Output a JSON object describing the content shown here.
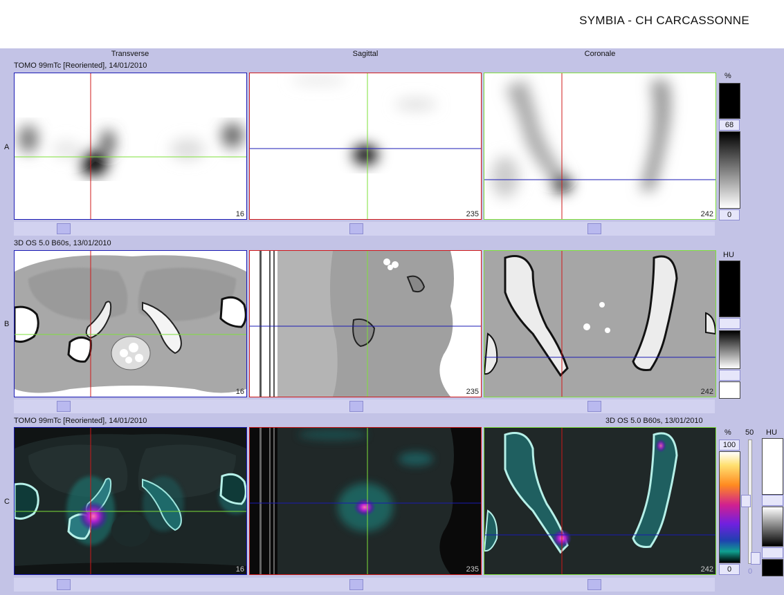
{
  "header": {
    "site_title": "SYMBIA - CH CARCASSONNE"
  },
  "columns": {
    "transverse": "Transverse",
    "sagittal": "Sagittal",
    "coronal": "Coronale"
  },
  "rows": {
    "a": {
      "letter": "A",
      "series": "TOMO 99mTc [Reoriented], 14/01/2010",
      "scale_unit": "%",
      "scale_top": "68",
      "scale_bottom": "0"
    },
    "b": {
      "letter": "B",
      "series": "3D  OS  5.0  B60s, 13/01/2010",
      "scale_unit": "HU"
    },
    "c": {
      "letter": "C",
      "series_left": "TOMO 99mTc [Reoriented], 14/01/2010",
      "series_right": "3D  OS  5.0  B60s, 13/01/2010",
      "scale_unit_pct": "%",
      "scale_unit_hu": "HU",
      "pct_top": "100",
      "pct_bottom": "0",
      "blend_top": "50",
      "blend_bottom": "0"
    }
  },
  "slices": {
    "transverse": "16",
    "sagittal": "235",
    "coronal": "242"
  },
  "colors": {
    "red_crosshair": "#d01818",
    "green_crosshair": "#7ee03a",
    "blue_crosshair": "#1a1ab4"
  }
}
